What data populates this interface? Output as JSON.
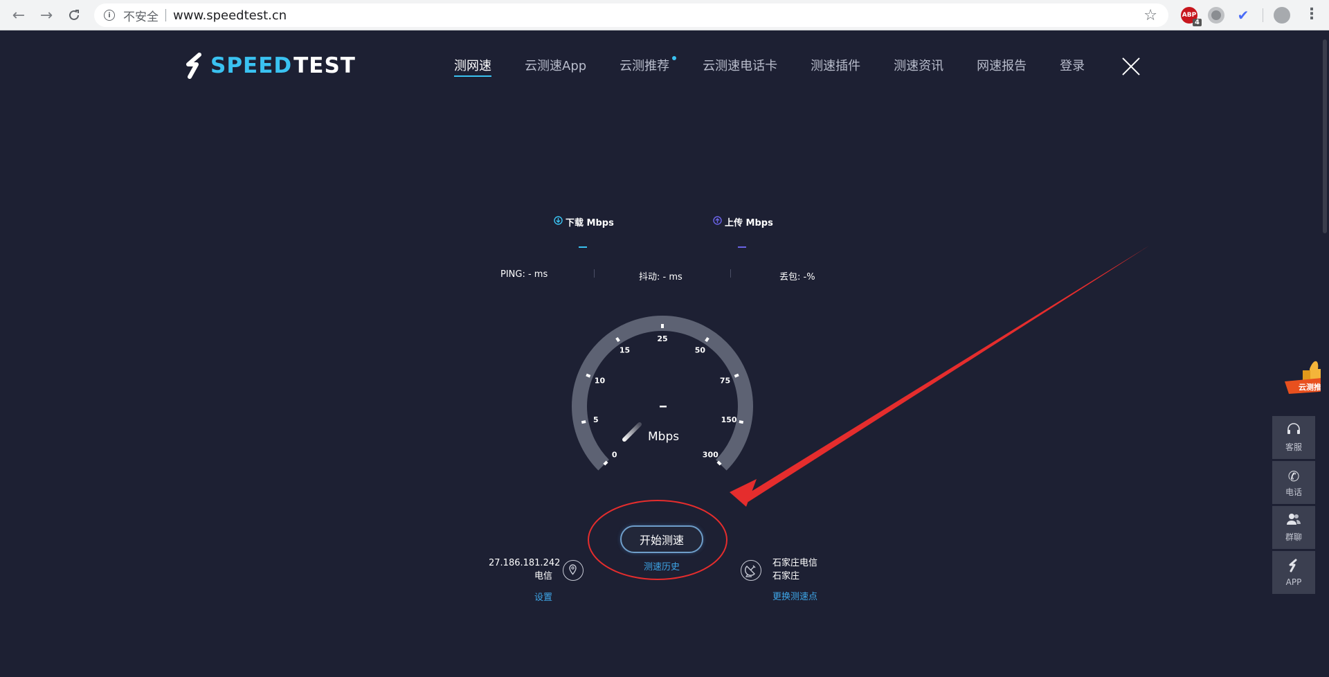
{
  "browser": {
    "security_label": "不安全",
    "url": "www.speedtest.cn",
    "abp_badge": "4",
    "abp_label": "ABP"
  },
  "logo": {
    "word_part1": "SPEED",
    "word_part2": "TEST"
  },
  "nav": {
    "items": [
      "测网速",
      "云测速App",
      "云测推荐",
      "云测速电话卡",
      "测速插件",
      "测速资讯",
      "网速报告",
      "登录"
    ],
    "active_index": 0
  },
  "metrics": {
    "download_label": "下载 Mbps",
    "download_value": "–",
    "upload_label": "上传 Mbps",
    "upload_value": "–",
    "ping": "PING:  - ms",
    "jitter": "抖动:  - ms",
    "loss": "丢包:  -%"
  },
  "gauge": {
    "ticks": [
      "0",
      "5",
      "10",
      "15",
      "25",
      "50",
      "75",
      "150",
      "300"
    ],
    "current_value": "–",
    "unit": "Mbps"
  },
  "client": {
    "ip": "27.186.181.242",
    "isp": "电信",
    "settings_link": "设置"
  },
  "server": {
    "name": "石家庄电信",
    "city": "石家庄",
    "change_link": "更换测速点"
  },
  "action": {
    "start_label": "开始测速",
    "history_link": "测速历史"
  },
  "float_panel": {
    "items": [
      {
        "label": "客服",
        "icon": "headset-icon"
      },
      {
        "label": "电话",
        "icon": "phone-icon"
      },
      {
        "label": "群聊",
        "icon": "group-chat-icon"
      },
      {
        "label": "APP",
        "icon": "app-logo-icon"
      }
    ],
    "promo_label": "云测推"
  },
  "colors": {
    "background": "#1d2033",
    "accent": "#3ac2f1",
    "link": "#3ea6e8",
    "gauge_track": "#5d6273",
    "annotation_red": "#e52d2d",
    "upload_accent": "#6a63e6"
  }
}
